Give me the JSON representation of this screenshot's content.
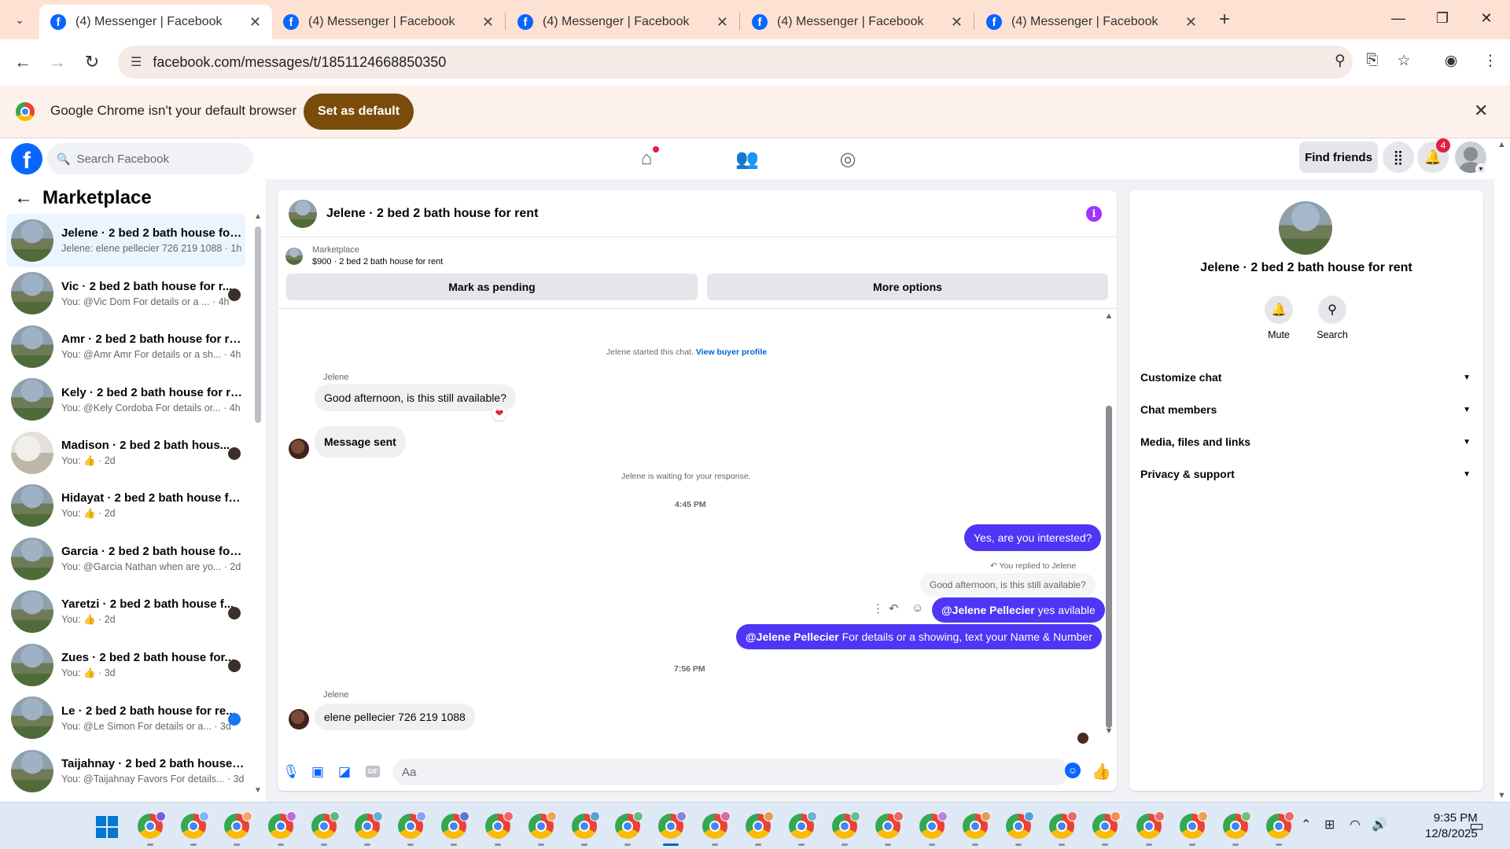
{
  "browser": {
    "tabs": [
      {
        "title": "(4) Messenger | Facebook",
        "close": "✕"
      },
      {
        "title": "(4) Messenger | Facebook",
        "close": "✕"
      },
      {
        "title": "(4) Messenger | Facebook",
        "close": "✕"
      },
      {
        "title": "(4) Messenger | Facebook",
        "close": "✕"
      },
      {
        "title": "(4) Messenger | Facebook",
        "close": "✕"
      }
    ],
    "new_tab": "+",
    "url": "facebook.com/messages/t/1851124668850350",
    "window_controls": {
      "minimize": "—",
      "maximize": "❐",
      "close": "✕"
    }
  },
  "infobar": {
    "message": "Google Chrome isn't your default browser",
    "button": "Set as default"
  },
  "fb_header": {
    "logo": "f",
    "search_placeholder": "Search Facebook",
    "find_friends": "Find friends",
    "notification_count": "4"
  },
  "sidebar": {
    "title": "Marketplace",
    "conversations": [
      {
        "name": "Jelene · 2 bed 2 bath house for ...",
        "preview": "Jelene: elene pellecier 726 219 1088 · 1h",
        "active": true
      },
      {
        "name": "Vic · 2 bed 2 bath house for r...",
        "preview": "You: @Vic Dom For details or a ... · 4h"
      },
      {
        "name": "Amr · 2 bed 2 bath house for rent",
        "preview": "You: @Amr Amr For details or a sh... · 4h"
      },
      {
        "name": "Kely · 2 bed 2 bath house for rent",
        "preview": "You: @Kely Cordoba For details or... · 4h"
      },
      {
        "name": "Madison · 2 bed 2 bath hous...",
        "preview": "You: 👍 · 2d"
      },
      {
        "name": "Hidayat · 2 bed 2 bath house fo...",
        "preview": "You: 👍 · 2d"
      },
      {
        "name": "Garcia · 2 bed 2 bath house for ...",
        "preview": "You: @Garcia Nathan when are yo... · 2d"
      },
      {
        "name": "Yaretzi · 2 bed 2 bath house f...",
        "preview": "You: 👍 · 2d"
      },
      {
        "name": "Zues · 2 bed 2 bath house for...",
        "preview": "You: 👍 · 3d"
      },
      {
        "name": "Le · 2 bed 2 bath house for re...",
        "preview": "You: @Le Simon For details or a... · 3d"
      },
      {
        "name": "Taijahnay · 2 bed 2 bath house f...",
        "preview": "You: @Taijahnay Favors For details... · 3d"
      }
    ]
  },
  "chat": {
    "title": "Jelene · 2 bed 2 bath house for rent",
    "marketplace_label": "Marketplace",
    "listing": "$900 · 2 bed 2 bath house for rent",
    "mark_pending": "Mark as pending",
    "more_options": "More options",
    "started_text": "Jelene started this chat.",
    "view_buyer": "View buyer profile",
    "sender_name": "Jelene",
    "msg1": "Good afternoon, is this still available?",
    "msg2": "Message sent",
    "waiting": "Jelene is waiting for your response.",
    "time1": "4:45 PM",
    "out1": "Yes, are you interested?",
    "replied_to": "You replied to Jelene",
    "quoted": "Good afternoon, is this still available?",
    "mention": "@Jelene Pellecier",
    "out2_rest": "yes avilable",
    "out3_rest": "For details or a showing, text your Name & Number",
    "time2": "7:56 PM",
    "sender_name2": "Jelene",
    "msg3": "elene pellecier  726  219 1088",
    "composer_placeholder": "Aa"
  },
  "right_panel": {
    "title": "Jelene · 2 bed 2 bath house for rent",
    "actions": [
      {
        "label": "Mute"
      },
      {
        "label": "Search"
      }
    ],
    "sections": [
      "Customize chat",
      "Chat members",
      "Media, files and links",
      "Privacy & support"
    ]
  },
  "taskbar": {
    "time": "9:35 PM",
    "date": "12/8/2025"
  },
  "colors": {
    "fb_blue": "#0866ff",
    "outgoing_bubble": "#4f35f5",
    "tab_strip": "#fde2d3",
    "set_default_button": "#7a4c09"
  },
  "icons": [
    "search-icon",
    "back-arrow-icon",
    "forward-arrow-icon",
    "reload-icon",
    "zoom-icon",
    "install-icon",
    "star-icon",
    "profile-icon",
    "menu-icon",
    "home-icon",
    "friends-icon",
    "groups-icon",
    "apps-grid-icon",
    "bell-icon",
    "info-icon",
    "heart-icon",
    "reply-icon",
    "emoji-icon",
    "more-icon",
    "mic-icon",
    "image-icon",
    "sticker-icon",
    "gif-icon",
    "like-icon",
    "chevron-down-icon",
    "windows-start-icon",
    "wifi-icon",
    "volume-icon"
  ]
}
